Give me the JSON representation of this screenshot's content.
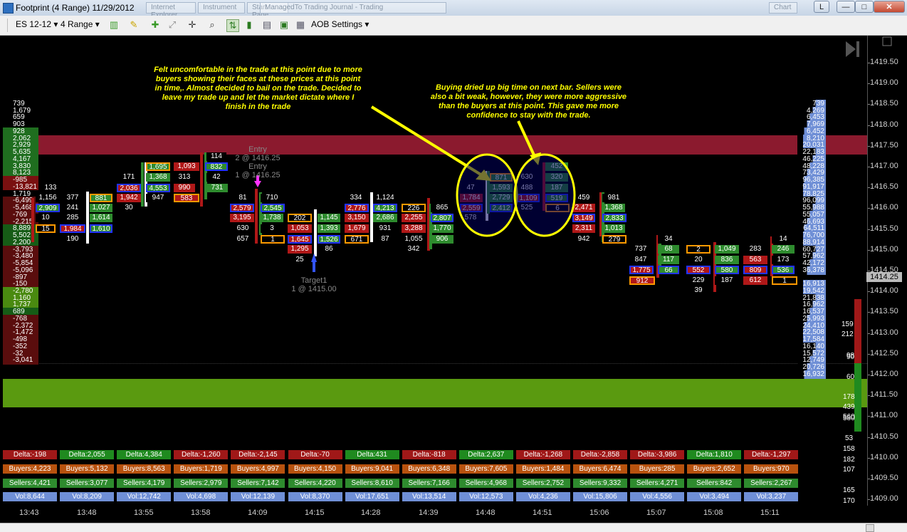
{
  "window": {
    "title": "Footprint (4 Range)  11/29/2012",
    "ghost_tabs": [
      "Internet Explorer",
      "Instrument",
      "Start Page",
      "Chart",
      "ManagedTo Trading Journal - Trading"
    ],
    "controls": [
      "L",
      "—",
      "□",
      "✕"
    ]
  },
  "toolbar": {
    "instrument": "ES 12-12",
    "period": "4 Range",
    "settings": "AOB Settings"
  },
  "y_axis": {
    "ticks": [
      "1419.50",
      "1419.00",
      "1418.50",
      "1418.00",
      "1417.50",
      "1417.00",
      "1416.50",
      "1416.00",
      "1415.50",
      "1415.00",
      "1414.50",
      "1414.00",
      "1413.50",
      "1413.00",
      "1412.50",
      "1412.00",
      "1411.50",
      "1411.00",
      "1410.50",
      "1410.00",
      "1409.50",
      "1409.00"
    ],
    "current_price": "1414.25"
  },
  "x_axis": {
    "times": [
      "13:43",
      "13:48",
      "13:55",
      "13:58",
      "14:09",
      "14:15",
      "14:28",
      "14:39",
      "14:48",
      "14:51",
      "15:06",
      "15:07",
      "15:08",
      "15:11"
    ]
  },
  "annotations": {
    "left": "Felt uncomfortable in the trade at this point due to more buyers showing their faces at these prices at this point in time,.  Almost decided to bail on the trade.  Decided to leave my trade up and let the market dictate where I finish in the trade",
    "right": "Buying dried up big time on next bar.  Sellers were also a bit weak, however, they were more aggressive than the buyers at this point.  This gave me more confidence to stay with the trade."
  },
  "orders": {
    "entry1_title": "Entry",
    "entry1_detail": "2 @ 1416.25",
    "entry2_title": "Entry",
    "entry2_detail": "1 @ 1416.25",
    "target_title": "Target1",
    "target_detail": "1 @ 1415.00"
  },
  "left_profile": [
    "739",
    "1,679",
    "659",
    "903",
    "928",
    "2,062",
    "2,929",
    "5,635",
    "4,167",
    "3,830",
    "8,123",
    "-985",
    "-13,821",
    "1,719",
    "-6,499",
    "-5,468",
    "-769",
    "-2,215",
    "8,889",
    "5,502",
    "2,200",
    "-3,793",
    "-3,480",
    "-5,854",
    "-5,096",
    "-897",
    "-150",
    "-2,780",
    "1,160",
    "1,737",
    "689",
    "-768",
    "-2,372",
    "-1,472",
    "-498",
    "-352",
    "-32",
    "-3,041"
  ],
  "right_profile": [
    "739",
    "4,269",
    "6,453",
    "7,969",
    "6,452",
    "8,210",
    "20,031",
    "22,183",
    "46,225",
    "48,228",
    "73,429",
    "96,385",
    "91,917",
    "78,825",
    "96,099",
    "55,988",
    "55,057",
    "46,693",
    "64,511",
    "76,700",
    "88,914",
    "60,727",
    "57,962",
    "42,172",
    "36,378",
    "",
    "16,913",
    "19,542",
    "21,838",
    "16,962",
    "16,537",
    "25,993",
    "24,410",
    "22,508",
    "17,584",
    "16,140",
    "15,572",
    "12,749",
    "20,726",
    "16,932"
  ],
  "volume_side": {
    "values": [
      "159",
      "212",
      "98",
      "90",
      "60",
      "178",
      "439",
      "560",
      "580",
      "53",
      "158",
      "182",
      "107",
      "165",
      "170"
    ]
  },
  "footprint_cells": [
    {
      "v": "133",
      "c": "#000"
    },
    {
      "v": "1,156",
      "c": "#000"
    },
    {
      "v": "2,909",
      "c": "#2e8b2e"
    },
    {
      "v": "10",
      "c": "#000"
    },
    {
      "v": "15",
      "c": "#000"
    },
    {
      "v": "377",
      "c": "#000"
    },
    {
      "v": "241",
      "c": "#000"
    },
    {
      "v": "285",
      "c": "#000"
    },
    {
      "v": "1,984",
      "c": "#b01818"
    },
    {
      "v": "190",
      "c": "#000"
    },
    {
      "v": "881",
      "c": "#2e8b2e"
    },
    {
      "v": "1,027",
      "c": "#2e8b2e"
    },
    {
      "v": "1,614",
      "c": "#2e8b2e"
    },
    {
      "v": "1,610",
      "c": "#2e8b2e"
    },
    {
      "v": "171",
      "c": "#000"
    },
    {
      "v": "2,036",
      "c": "#b01818"
    },
    {
      "v": "1,942",
      "c": "#b01818"
    },
    {
      "v": "30",
      "c": "#000"
    },
    {
      "v": "1,695",
      "c": "#2e8b2e"
    },
    {
      "v": "1,368",
      "c": "#2e8b2e"
    },
    {
      "v": "4,553",
      "c": "#2e8b2e"
    },
    {
      "v": "947",
      "c": "#000"
    },
    {
      "v": "1,093",
      "c": "#b01818"
    },
    {
      "v": "313",
      "c": "#000"
    },
    {
      "v": "990",
      "c": "#b01818"
    },
    {
      "v": "583",
      "c": "#b01818"
    },
    {
      "v": "114",
      "c": "#000"
    },
    {
      "v": "832",
      "c": "#2e8b2e"
    },
    {
      "v": "42",
      "c": "#000"
    },
    {
      "v": "731",
      "c": "#2e8b2e"
    },
    {
      "v": "81",
      "c": "#000"
    },
    {
      "v": "2,579",
      "c": "#b01818"
    },
    {
      "v": "3,195",
      "c": "#b01818"
    },
    {
      "v": "630",
      "c": "#000"
    },
    {
      "v": "657",
      "c": "#000"
    },
    {
      "v": "710",
      "c": "#000"
    },
    {
      "v": "2,545",
      "c": "#2e8b2e"
    },
    {
      "v": "1,738",
      "c": "#2e8b2e"
    },
    {
      "v": "3",
      "c": "#000"
    },
    {
      "v": "1",
      "c": "#000"
    },
    {
      "v": "202",
      "c": "#000"
    },
    {
      "v": "1,053",
      "c": "#b01818"
    },
    {
      "v": "1,645",
      "c": "#b01818"
    },
    {
      "v": "1,295",
      "c": "#b01818"
    },
    {
      "v": "25",
      "c": "#000"
    },
    {
      "v": "1,145",
      "c": "#2e8b2e"
    },
    {
      "v": "1,393",
      "c": "#2e8b2e"
    },
    {
      "v": "1,526",
      "c": "#2e8b2e"
    },
    {
      "v": "86",
      "c": "#000"
    },
    {
      "v": "334",
      "c": "#000"
    },
    {
      "v": "2,776",
      "c": "#b01818"
    },
    {
      "v": "3,150",
      "c": "#b01818"
    },
    {
      "v": "1,679",
      "c": "#b01818"
    },
    {
      "v": "671",
      "c": "#000"
    },
    {
      "v": "1,124",
      "c": "#000"
    },
    {
      "v": "4,213",
      "c": "#2e8b2e"
    },
    {
      "v": "2,686",
      "c": "#2e8b2e"
    },
    {
      "v": "931",
      "c": "#000"
    },
    {
      "v": "87",
      "c": "#000"
    },
    {
      "v": "226",
      "c": "#000"
    },
    {
      "v": "2,255",
      "c": "#b01818"
    },
    {
      "v": "3,288",
      "c": "#b01818"
    },
    {
      "v": "1,055",
      "c": "#000"
    },
    {
      "v": "342",
      "c": "#000"
    },
    {
      "v": "865",
      "c": "#000"
    },
    {
      "v": "2,807",
      "c": "#2e8b2e"
    },
    {
      "v": "1,770",
      "c": "#2e8b2e"
    },
    {
      "v": "906",
      "c": "#2e8b2e"
    },
    {
      "v": "47",
      "c": "#000"
    },
    {
      "v": "1,784",
      "c": "#b01818"
    },
    {
      "v": "2,559",
      "c": "#b01818"
    },
    {
      "v": "578",
      "c": "#000"
    },
    {
      "v": "871",
      "c": "#2e8b2e"
    },
    {
      "v": "1,593",
      "c": "#2e8b2e"
    },
    {
      "v": "2,729",
      "c": "#2e8b2e"
    },
    {
      "v": "2,412",
      "c": "#2e8b2e"
    },
    {
      "v": "630",
      "c": "#000"
    },
    {
      "v": "488",
      "c": "#000"
    },
    {
      "v": "1,109",
      "c": "#b01818"
    },
    {
      "v": "525",
      "c": "#000"
    },
    {
      "v": "452",
      "c": "#2e8b2e"
    },
    {
      "v": "320",
      "c": "#2e8b2e"
    },
    {
      "v": "187",
      "c": "#2e8b2e"
    },
    {
      "v": "519",
      "c": "#2e8b2e"
    },
    {
      "v": "6",
      "c": "#000"
    },
    {
      "v": "459",
      "c": "#000"
    },
    {
      "v": "2,471",
      "c": "#b01818"
    },
    {
      "v": "3,149",
      "c": "#b01818"
    },
    {
      "v": "2,311",
      "c": "#b01818"
    },
    {
      "v": "942",
      "c": "#000"
    },
    {
      "v": "981",
      "c": "#000"
    },
    {
      "v": "1,368",
      "c": "#2e8b2e"
    },
    {
      "v": "2,833",
      "c": "#2e8b2e"
    },
    {
      "v": "1,013",
      "c": "#2e8b2e"
    },
    {
      "v": "279",
      "c": "#000"
    },
    {
      "v": "737",
      "c": "#000"
    },
    {
      "v": "847",
      "c": "#000"
    },
    {
      "v": "1,775",
      "c": "#b01818"
    },
    {
      "v": "912",
      "c": "#b01818"
    },
    {
      "v": "34",
      "c": "#000"
    },
    {
      "v": "68",
      "c": "#2e8b2e"
    },
    {
      "v": "117",
      "c": "#2e8b2e"
    },
    {
      "v": "66",
      "c": "#2e8b2e"
    },
    {
      "v": "2",
      "c": "#000"
    },
    {
      "v": "20",
      "c": "#000"
    },
    {
      "v": "552",
      "c": "#b01818"
    },
    {
      "v": "229",
      "c": "#000"
    },
    {
      "v": "39",
      "c": "#000"
    },
    {
      "v": "1,049",
      "c": "#2e8b2e"
    },
    {
      "v": "836",
      "c": "#2e8b2e"
    },
    {
      "v": "580",
      "c": "#2e8b2e"
    },
    {
      "v": "187",
      "c": "#000"
    },
    {
      "v": "283",
      "c": "#000"
    },
    {
      "v": "563",
      "c": "#b01818"
    },
    {
      "v": "809",
      "c": "#b01818"
    },
    {
      "v": "612",
      "c": "#b01818"
    },
    {
      "v": "14",
      "c": "#000"
    },
    {
      "v": "246",
      "c": "#2e8b2e"
    },
    {
      "v": "173",
      "c": "#000"
    },
    {
      "v": "536",
      "c": "#2e8b2e"
    },
    {
      "v": "1",
      "c": "#000"
    }
  ],
  "bar_stats": [
    {
      "delta": "Delta:-198",
      "buyers": "Buyers:4,223",
      "sellers": "Sellers:4,421",
      "vol": "Vol:8,644"
    },
    {
      "delta": "Delta:2,055",
      "buyers": "Buyers:5,132",
      "sellers": "Sellers:3,077",
      "vol": "Vol:8,209"
    },
    {
      "delta": "Delta:4,384",
      "buyers": "Buyers:8,563",
      "sellers": "Sellers:4,179",
      "vol": "Vol:12,742"
    },
    {
      "delta": "Delta:-1,260",
      "buyers": "Buyers:1,719",
      "sellers": "Sellers:2,979",
      "vol": "Vol:4,698"
    },
    {
      "delta": "Delta:-2,145",
      "buyers": "Buyers:4,997",
      "sellers": "Sellers:7,142",
      "vol": "Vol:12,139"
    },
    {
      "delta": "Delta:-70",
      "buyers": "Buyers:4,150",
      "sellers": "Sellers:4,220",
      "vol": "Vol:8,370"
    },
    {
      "delta": "Delta:431",
      "buyers": "Buyers:9,041",
      "sellers": "Sellers:8,610",
      "vol": "Vol:17,651"
    },
    {
      "delta": "Delta:-818",
      "buyers": "Buyers:6,348",
      "sellers": "Sellers:7,166",
      "vol": "Vol:13,514"
    },
    {
      "delta": "Delta:2,637",
      "buyers": "Buyers:7,605",
      "sellers": "Sellers:4,968",
      "vol": "Vol:12,573"
    },
    {
      "delta": "Delta:-1,268",
      "buyers": "Buyers:1,484",
      "sellers": "Sellers:2,752",
      "vol": "Vol:4,236"
    },
    {
      "delta": "Delta:-2,858",
      "buyers": "Buyers:6,474",
      "sellers": "Sellers:9,332",
      "vol": "Vol:15,806"
    },
    {
      "delta": "Delta:-3,986",
      "buyers": "Buyers:285",
      "sellers": "Sellers:4,271",
      "vol": "Vol:4,556"
    },
    {
      "delta": "Delta:1,810",
      "buyers": "Buyers:2,652",
      "sellers": "Sellers:842",
      "vol": "Vol:3,494"
    },
    {
      "delta": "Delta:-1,297",
      "buyers": "Buyers:970",
      "sellers": "Sellers:2,267",
      "vol": "Vol:3,237"
    }
  ],
  "colors": {
    "delta_pos": "#1f8a1f",
    "delta_neg": "#a01818",
    "buyers": "#b8520e",
    "sellers": "#2e8b2e",
    "vol": "#6f8fd6",
    "resistance_band": "#8b1a2e",
    "support_band": "#5a9a10",
    "annotation": "#ffff00"
  }
}
